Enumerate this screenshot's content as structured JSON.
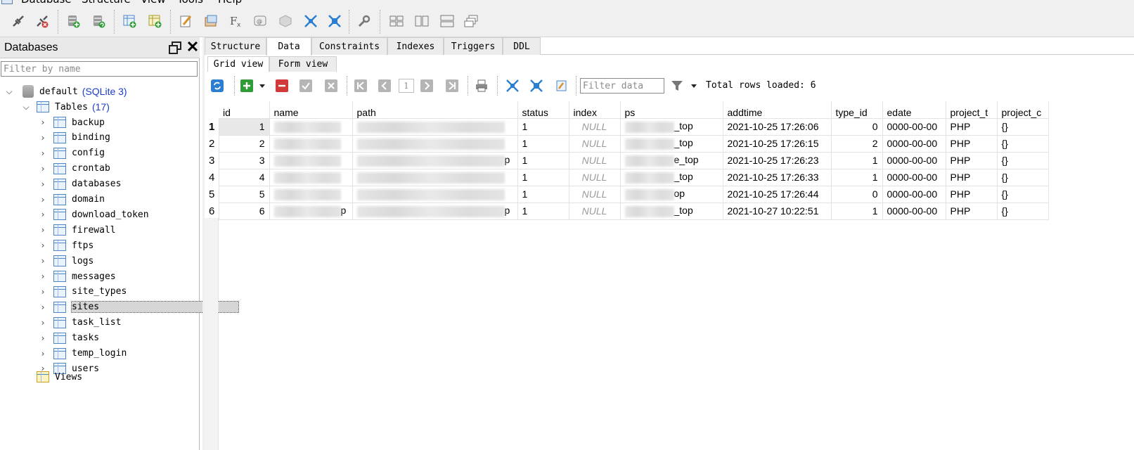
{
  "menu": [
    "Database",
    "Structure",
    "View",
    "Tools",
    "Help"
  ],
  "toolbar": {
    "icons": [
      "connect-icon",
      "disconnect-icon",
      "add-database-icon",
      "refresh-database-icon",
      "new-table-icon",
      "new-index-icon",
      "edit-icon",
      "new-view-icon",
      "function-icon",
      "sql-editor-icon",
      "object-icon",
      "collapse-icon",
      "expand-icon",
      "wrench-icon",
      "tile-icon",
      "split-vertical-icon",
      "split-horizontal-icon",
      "cascade-icon"
    ]
  },
  "left_panel": {
    "title": "Databases",
    "filter_placeholder": "Filter by name",
    "db_name": "default",
    "db_type": "(SQLite 3)",
    "tables_label": "Tables",
    "tables_count": "(17)",
    "tables": [
      "backup",
      "binding",
      "config",
      "crontab",
      "databases",
      "domain",
      "download_token",
      "firewall",
      "ftps",
      "logs",
      "messages",
      "site_types",
      "sites",
      "task_list",
      "tasks",
      "temp_login",
      "users"
    ],
    "selected_table": "sites",
    "views_label": "Views"
  },
  "tabs": [
    "Structure",
    "Data",
    "Constraints",
    "Indexes",
    "Triggers",
    "DDL"
  ],
  "active_tab": "Data",
  "subtabs": [
    "Grid view",
    "Form view"
  ],
  "active_subtab": "Grid view",
  "data_toolbar": {
    "page": "1",
    "filter_placeholder": "Filter data",
    "rows_loaded": "Total rows loaded: 6"
  },
  "grid": {
    "columns": [
      "id",
      "name",
      "path",
      "status",
      "index",
      "ps",
      "addtime",
      "type_id",
      "edate",
      "project_t",
      "project_c"
    ],
    "rows": [
      {
        "rn": "1",
        "id": "1",
        "name": "",
        "path": "",
        "status": "1",
        "index": "NULL",
        "ps": "_top",
        "addtime": "2021-10-25 17:26:06",
        "type_id": "0",
        "edate": "0000-00-00",
        "project_t": "PHP",
        "project_c": "{}"
      },
      {
        "rn": "2",
        "id": "2",
        "name": "",
        "path": "",
        "status": "1",
        "index": "NULL",
        "ps": "_top",
        "addtime": "2021-10-25 17:26:15",
        "type_id": "2",
        "edate": "0000-00-00",
        "project_t": "PHP",
        "project_c": "{}"
      },
      {
        "rn": "3",
        "id": "3",
        "name": "",
        "path": "p",
        "status": "1",
        "index": "NULL",
        "ps": "e_top",
        "addtime": "2021-10-25 17:26:23",
        "type_id": "1",
        "edate": "0000-00-00",
        "project_t": "PHP",
        "project_c": "{}"
      },
      {
        "rn": "4",
        "id": "4",
        "name": "",
        "path": "",
        "status": "1",
        "index": "NULL",
        "ps": "_top",
        "addtime": "2021-10-25 17:26:33",
        "type_id": "1",
        "edate": "0000-00-00",
        "project_t": "PHP",
        "project_c": "{}"
      },
      {
        "rn": "5",
        "id": "5",
        "name": "",
        "path": "",
        "status": "1",
        "index": "NULL",
        "ps": "op",
        "addtime": "2021-10-25 17:26:44",
        "type_id": "0",
        "edate": "0000-00-00",
        "project_t": "PHP",
        "project_c": "{}"
      },
      {
        "rn": "6",
        "id": "6",
        "name": "p",
        "path": "p",
        "status": "1",
        "index": "NULL",
        "ps": "_top",
        "addtime": "2021-10-27 10:22:51",
        "type_id": "1",
        "edate": "0000-00-00",
        "project_t": "PHP",
        "project_c": "{}"
      }
    ]
  },
  "colors": {
    "selection": "#d6d6d6",
    "link_blue": "#1a3cc9",
    "null_gray": "#9a9a9a",
    "toolbar_bg": "#f0f0f0"
  }
}
